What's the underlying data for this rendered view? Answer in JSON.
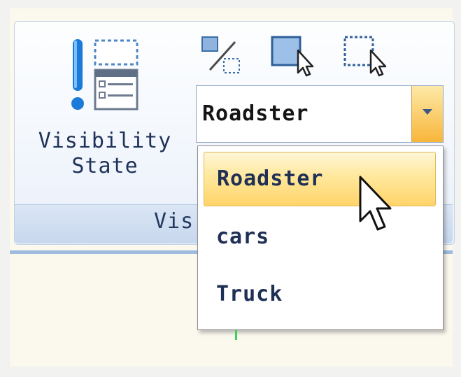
{
  "panel": {
    "title": "Vis"
  },
  "visibility_state": {
    "label_line1": "Visibility",
    "label_line2": "State"
  },
  "combo": {
    "selected_value": "Roadster"
  },
  "dropdown": {
    "items": [
      {
        "label": "Roadster",
        "selected": true
      },
      {
        "label": "cars",
        "selected": false
      },
      {
        "label": "Truck",
        "selected": false
      }
    ]
  },
  "icons": {
    "visibility_state": "visibility-state-icon",
    "toggle_visibility": "toggle-visibility-icon",
    "make_visible": "make-visible-icon",
    "make_invisible": "make-invisible-icon",
    "dropdown_arrow": "chevron-down-icon",
    "cursor": "mouse-pointer-icon"
  },
  "colors": {
    "accent_blue": "#1a7bd8",
    "ribbon_text": "#23385e",
    "hover_gold": "#ffd46a",
    "arrow_orange": "#f8b63a"
  }
}
